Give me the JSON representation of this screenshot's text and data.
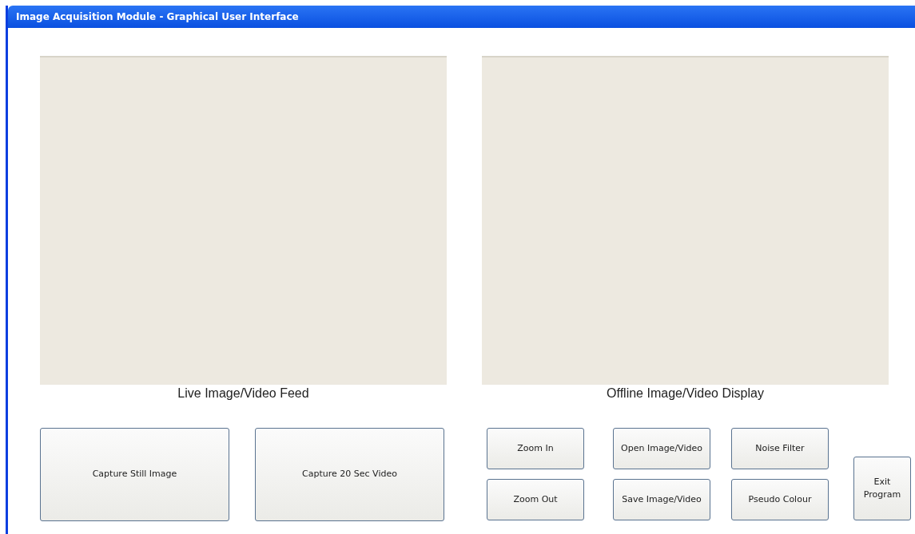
{
  "window": {
    "title": "Image Acquisition Module - Graphical User Interface"
  },
  "panels": [
    {
      "label": "Live Image/Video Feed",
      "button_columns": [
        [
          "Capture Still Image"
        ],
        [
          "Capture 20 Sec Video"
        ]
      ]
    },
    {
      "label": "Offline Image/Video Display",
      "button_columns": [
        [
          "Zoom In",
          "Zoom Out"
        ],
        [
          "Open Image/Video",
          "Save Image/Video"
        ],
        [
          "Noise Filter",
          "Pseudo Colour"
        ],
        [
          "Exit Program"
        ]
      ]
    }
  ]
}
